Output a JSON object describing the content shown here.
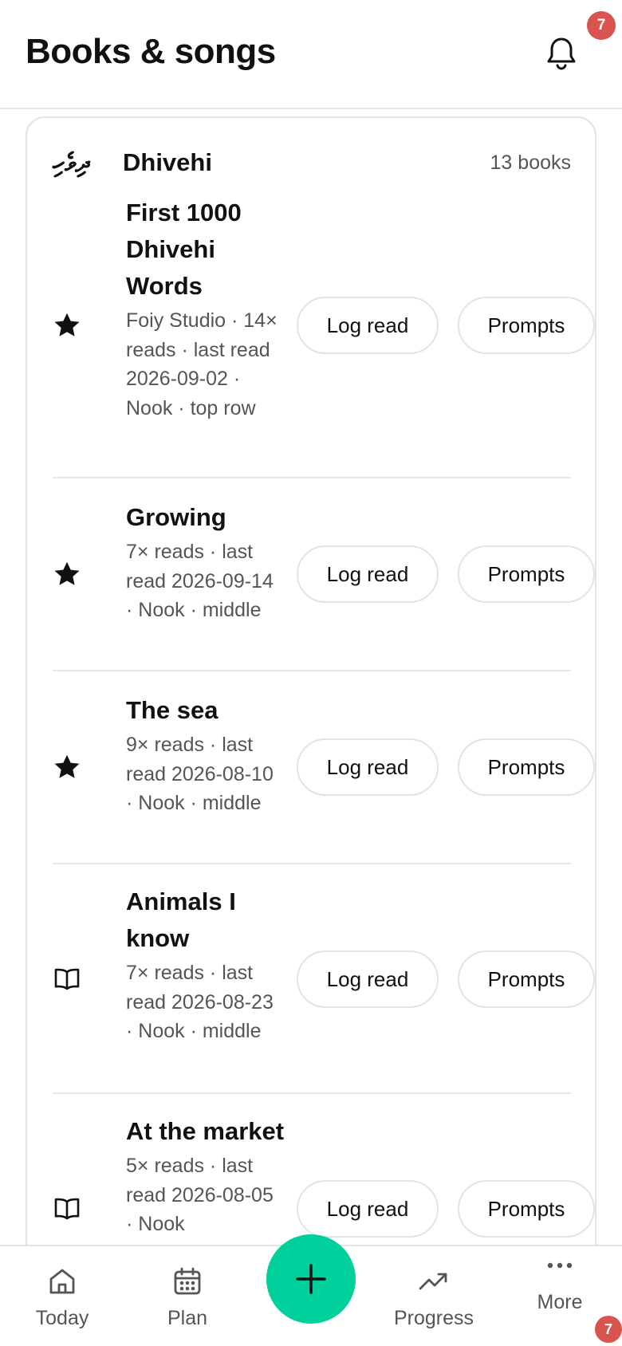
{
  "header": {
    "title": "Books & songs",
    "bell_icon": "bell-icon",
    "notification_count": "7"
  },
  "section": {
    "language_script": "ދިވެހި",
    "language_name": "Dhivehi",
    "count_label": "13 books",
    "books": [
      {
        "title": "First 1000 Dhivehi Words",
        "meta": "Foiy Studio · 14× reads · last read 2026-09-02 · Nook · top row",
        "icon": "star-icon",
        "log_label": "Log read",
        "prompts_label": "Prompts"
      },
      {
        "title": "Growing",
        "meta": "7× reads · last read 2026-09-14 · Nook · middle",
        "icon": "star-icon",
        "log_label": "Log read",
        "prompts_label": "Prompts"
      },
      {
        "title": "The sea",
        "meta": "9× reads · last read 2026-08-10 · Nook · middle",
        "icon": "star-icon",
        "log_label": "Log read",
        "prompts_label": "Prompts"
      },
      {
        "title": "Animals I know",
        "meta": "7× reads · last read 2026-08-23 · Nook · middle",
        "icon": "book-icon",
        "log_label": "Log read",
        "prompts_label": "Prompts"
      },
      {
        "title": "At the market",
        "meta": "5× reads · last read 2026-08-05 · Nook",
        "icon": "book-icon",
        "log_label": "Log read",
        "prompts_label": "Prompts"
      }
    ]
  },
  "tabbar": {
    "tabs": [
      {
        "label": "Today",
        "icon": "home-icon"
      },
      {
        "label": "Plan",
        "icon": "calendar-icon"
      },
      {
        "label": "Progress",
        "icon": "trend-up-icon"
      },
      {
        "label": "More",
        "icon": "more-dots-icon"
      }
    ],
    "fab_icon": "plus-icon",
    "more_badge": "7"
  },
  "colors": {
    "accent": "#00d09c",
    "badge": "#d9534f",
    "text": "#111111",
    "muted": "#555555",
    "border": "#e3e3e3"
  }
}
